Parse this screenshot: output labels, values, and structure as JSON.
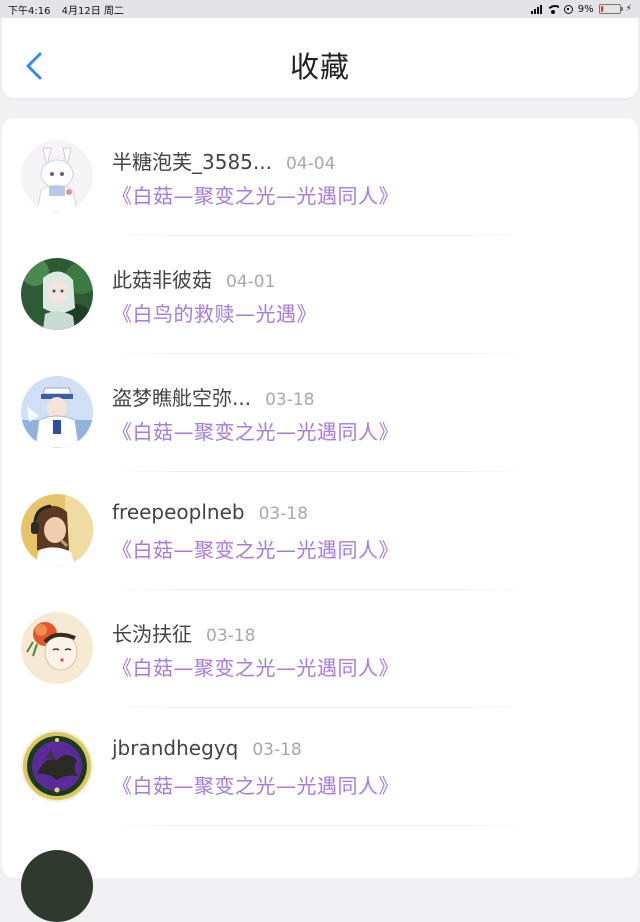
{
  "status_bar": {
    "time": "下午4:16",
    "date": "4月12日 周二",
    "battery_percent": 9,
    "battery_label": "9%",
    "battery_color": "#e0302a"
  },
  "header": {
    "title": "收藏",
    "back_icon": "chevron-left-icon",
    "accent_color": "#2f8ef5"
  },
  "favorites": [
    {
      "username": "半糖泡芙_3585...",
      "date": "04-04",
      "work_title": "《白菇—聚变之光—光遇同人》",
      "avatar": "anime-white-hair-bunny"
    },
    {
      "username": "此菇非彼菇",
      "date": "04-01",
      "work_title": "《白鸟的救赎—光遇》",
      "avatar": "anime-green-forest"
    },
    {
      "username": "盗梦瞧舭空弥...",
      "date": "03-18",
      "work_title": "《白菇—聚变之光—光遇同人》",
      "avatar": "anime-white-suit-blue-sky"
    },
    {
      "username": "freepeoplneb",
      "date": "03-18",
      "work_title": "《白菇—聚变之光—光遇同人》",
      "avatar": "photo-girl-headphones"
    },
    {
      "username": "长沩扶征",
      "date": "03-18",
      "work_title": "《白菇—聚变之光—光遇同人》",
      "avatar": "illustration-flower-hair"
    },
    {
      "username": "jbrandhegyq",
      "date": "03-18",
      "work_title": "《白菇—聚变之光—光遇同人》",
      "avatar": "emblem-purple-dragon"
    }
  ],
  "colors": {
    "title_purple": "#a97ad8",
    "date_gray": "#a8a8a8",
    "background": "#f1f1f3"
  }
}
